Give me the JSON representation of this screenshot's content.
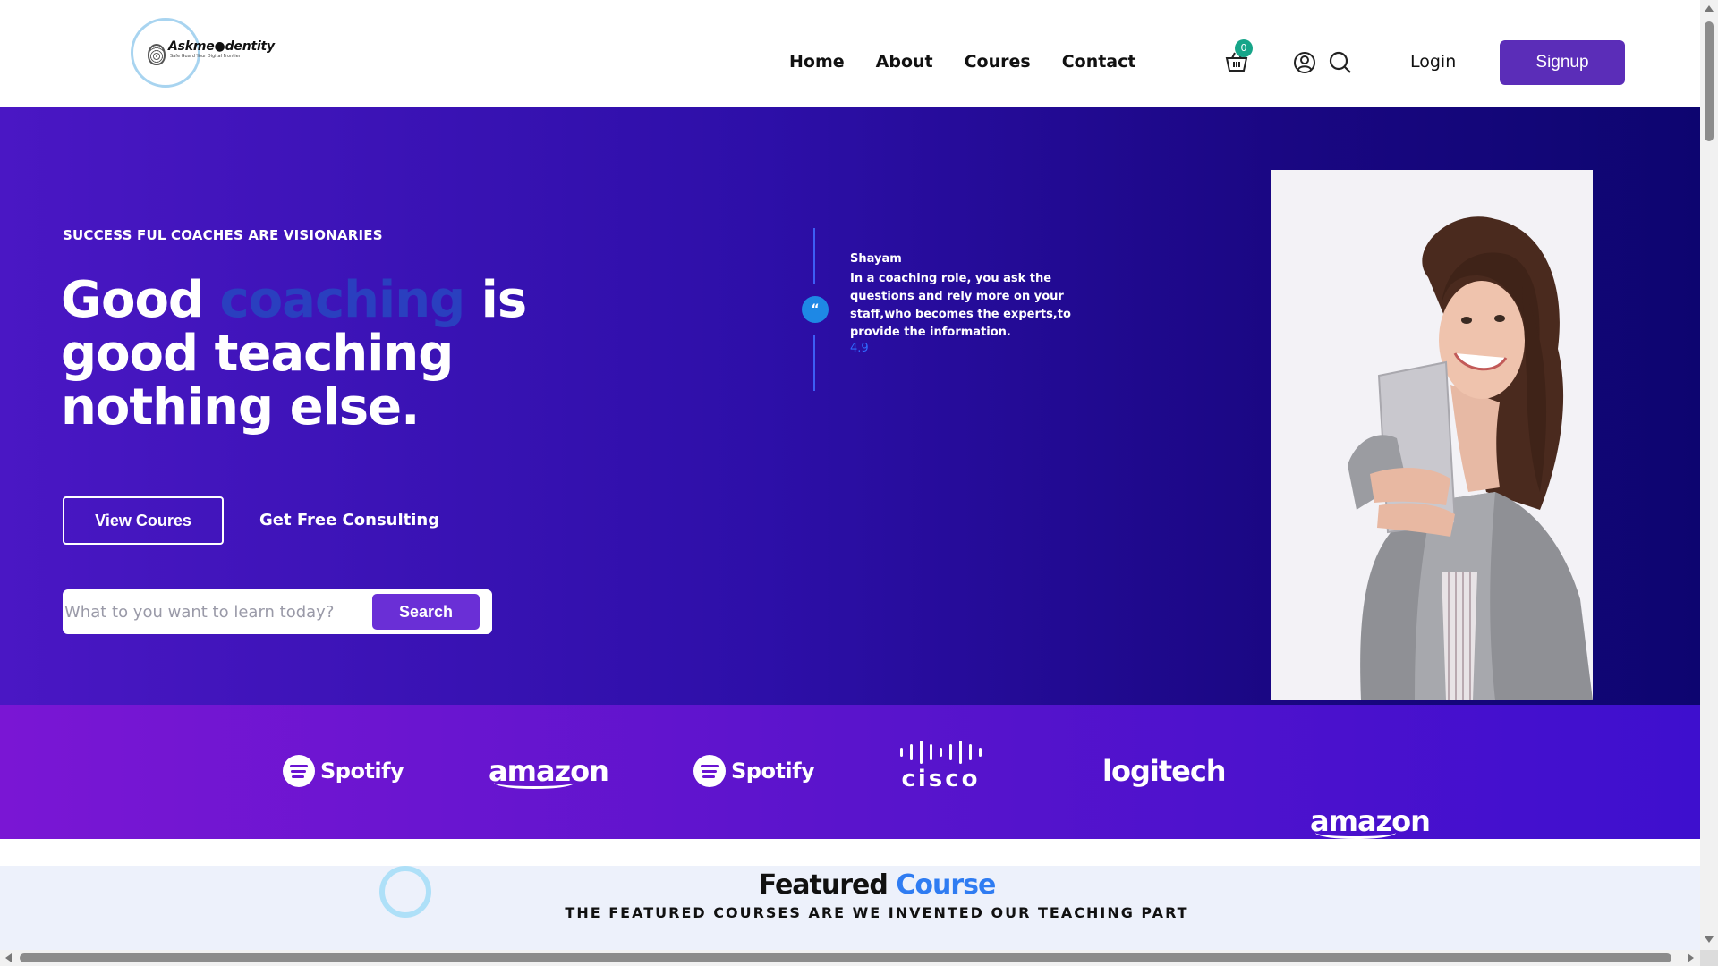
{
  "brand": {
    "name": "Askme●dentity",
    "tagline": "Safe Guard Your Digital Frontier"
  },
  "nav": {
    "links": [
      "Home",
      "About",
      "Coures",
      "Contact"
    ],
    "cart_count": "0",
    "login_label": "Login",
    "signup_label": "Signup",
    "icons": [
      "cart-icon",
      "user-icon",
      "search-icon"
    ]
  },
  "hero": {
    "eyebrow": "SUCCESS FUL COACHES ARE VISIONARIES",
    "headline_pre": "Good ",
    "headline_accent": "coaching",
    "headline_post": " is good teaching nothing else.",
    "view_courses_label": "View Coures",
    "consulting_label": "Get Free Consulting",
    "search_placeholder": "What to you want to learn today?",
    "search_button_label": "Search",
    "testimonial": {
      "quote_mark": "“",
      "name": "Shayam",
      "text": "In a coaching role, you ask the questions and rely more on your staff,who becomes the experts,to provide the information.",
      "rating": "4.9"
    }
  },
  "partners": [
    "Spotify",
    "amazon",
    "Spotify",
    "cisco",
    "logitech",
    "amazon"
  ],
  "featured": {
    "title_pre": "Featured ",
    "title_accent": "Course",
    "subtitle": "THE FEATURED COURSES ARE WE INVENTED OUR TEACHING PART"
  },
  "colors": {
    "signup_bg": "#5b2db8",
    "hero_start": "#4a17c4",
    "hero_end": "#0d0570",
    "accent_blue": "#2f7cf2",
    "badge_green": "#17a589"
  }
}
